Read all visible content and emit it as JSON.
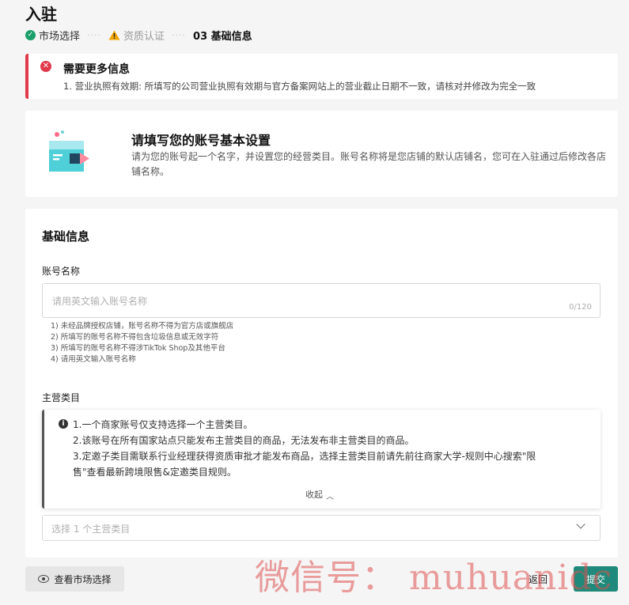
{
  "header": {
    "title": "入驻"
  },
  "steps": [
    {
      "label": "市场选择",
      "status": "done"
    },
    {
      "label": "资质认证",
      "status": "warning"
    },
    {
      "label": "03 基础信息",
      "status": "current"
    }
  ],
  "steps_separator": "····",
  "alert": {
    "title": "需要更多信息",
    "message": "1. 营业执照有效期: 所填写的公司营业执照有效期与官方备案网站上的营业截止日期不一致，请核对并修改为完全一致"
  },
  "intro": {
    "title": "请填写您的账号基本设置",
    "description": "请为您的账号起一个名字，并设置您的经营类目。账号名称将是您店铺的默认店铺名，您可在入驻通过后修改各店铺名称。"
  },
  "form": {
    "section_title": "基础信息",
    "account_name": {
      "label": "账号名称",
      "placeholder": "请用英文输入账号名称",
      "value": "",
      "char_count": "0/120",
      "hints": [
        "1) 未经品牌授权店铺，账号名称不得为官方店或旗舰店",
        "2) 所填写的账号名称不得包含垃圾信息或无效字符",
        "3) 所填写的账号名称不得涉TikTok Shop及其他平台",
        "4) 请用英文输入账号名称"
      ]
    },
    "main_category": {
      "label": "主营类目",
      "info_lines": [
        "1.一个商家账号仅支持选择一个主营类目。",
        "2.该账号在所有国家站点只能发布主营类目的商品，无法发布非主营类目的商品。",
        "3.定邀子类目需联系行业经理获得资质审批才能发布商品，选择主营类目前请先前往商家大学-规则中心搜索\"限",
        "售\"查看最新跨境限售&定邀类目规则。"
      ],
      "collapse_label": "收起",
      "placeholder": "选择 1 个主营类目"
    }
  },
  "footer": {
    "view_market_label": "查看市场选择",
    "back_label": "返回",
    "submit_label": "提交"
  },
  "watermark": "微信号： muhuanidc",
  "colors": {
    "accent": "#1f8a7b",
    "success": "#1a9e6a",
    "warning": "#f0a500",
    "error": "#e0394a"
  }
}
